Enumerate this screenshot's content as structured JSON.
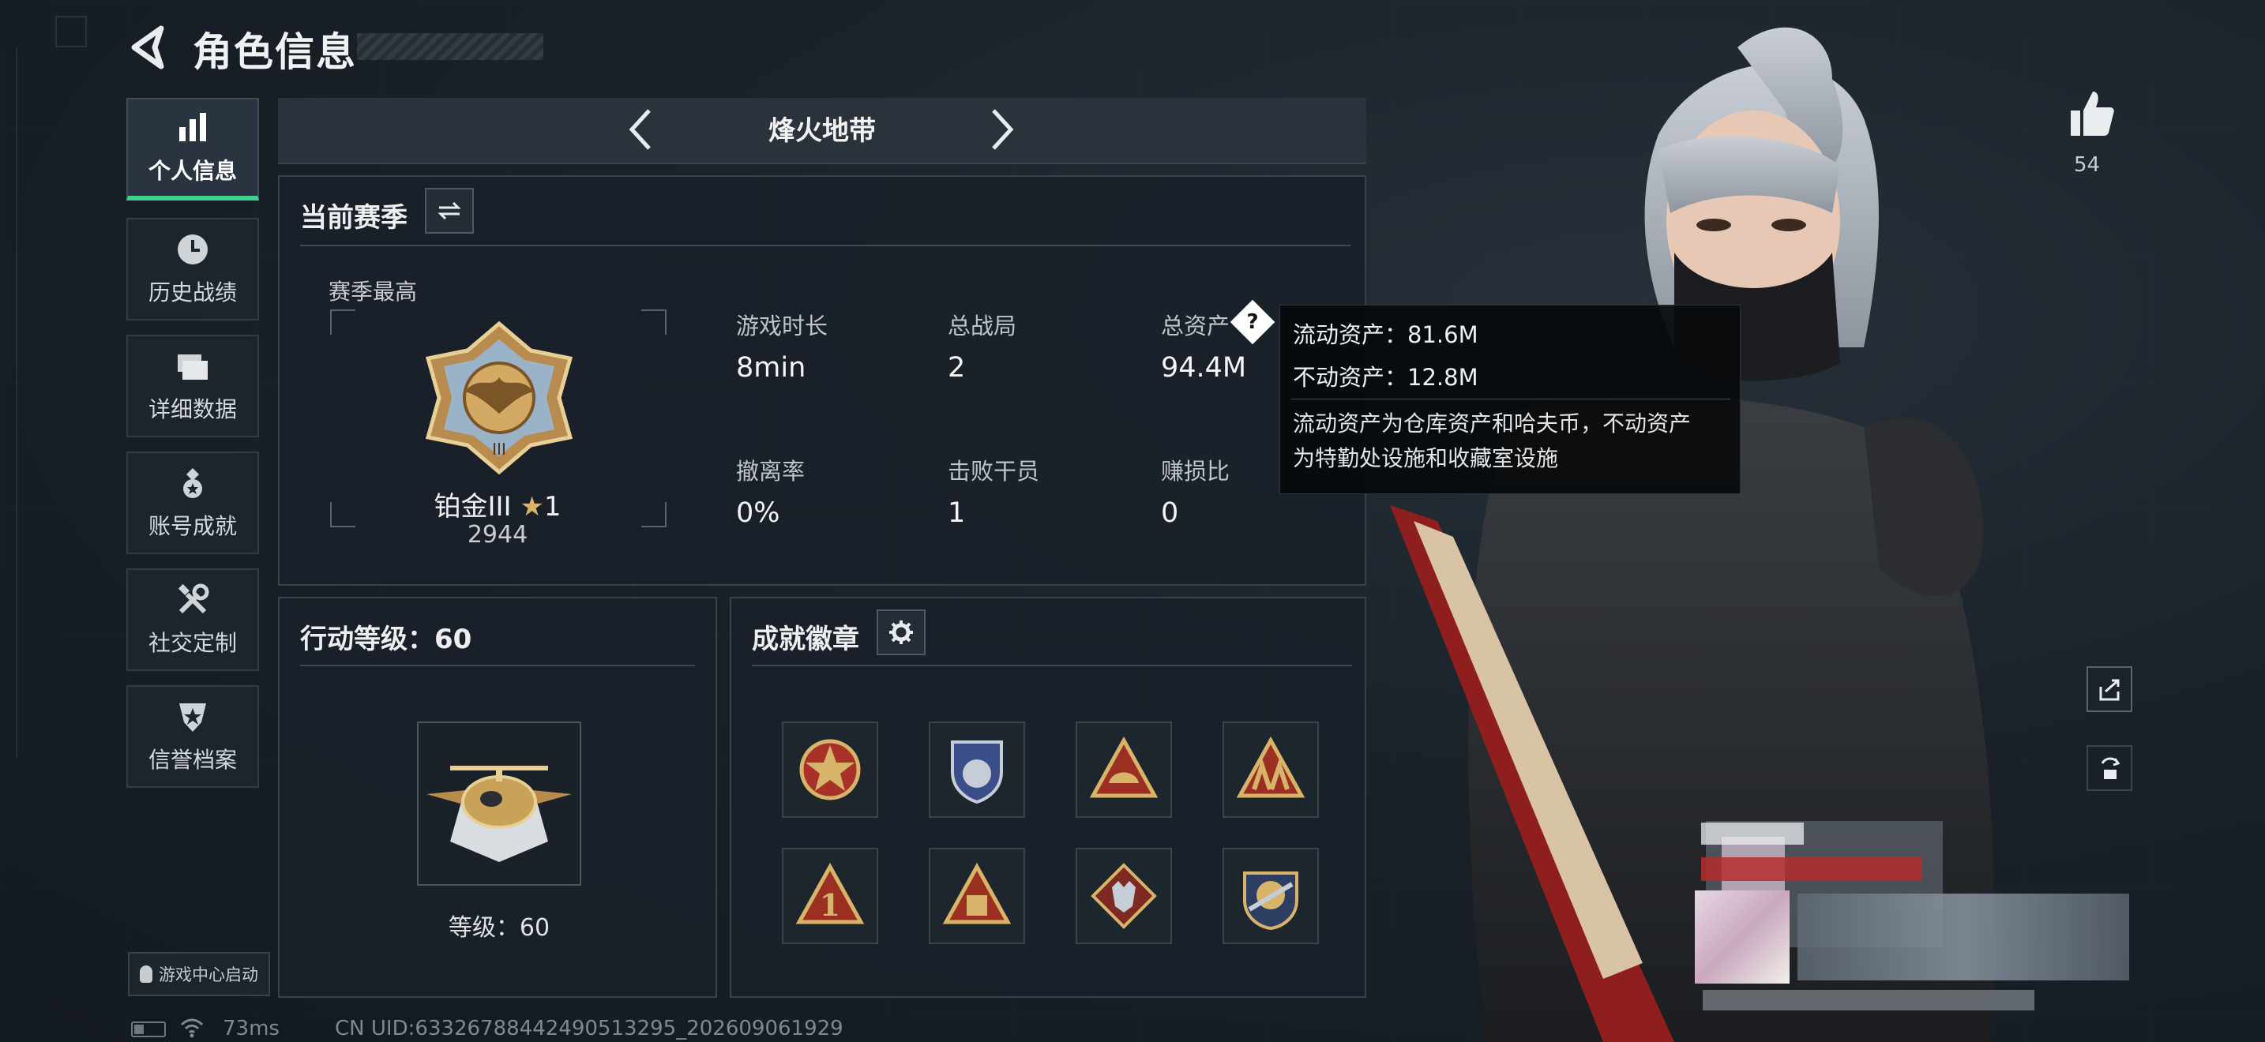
{
  "header": {
    "title": "角色信息"
  },
  "sidebar": {
    "items": [
      {
        "label": "个人信息",
        "icon": "bar-chart-icon",
        "active": true
      },
      {
        "label": "历史战绩",
        "icon": "clock-icon",
        "active": false
      },
      {
        "label": "详细数据",
        "icon": "folder-icon",
        "active": false
      },
      {
        "label": "账号成就",
        "icon": "medal-icon",
        "active": false
      },
      {
        "label": "社交定制",
        "icon": "tools-icon",
        "active": false
      },
      {
        "label": "信誉档案",
        "icon": "shield-star-icon",
        "active": false
      }
    ],
    "launch_label": "游戏中心启动"
  },
  "mode": {
    "name": "烽火地带"
  },
  "season": {
    "title": "当前赛季",
    "best_label": "赛季最高",
    "rank_name": "铂金III",
    "rank_stars": "1",
    "rank_score": "2944",
    "stats": [
      {
        "label": "游戏时长",
        "value": "8min"
      },
      {
        "label": "总战局",
        "value": "2"
      },
      {
        "label": "总资产",
        "value": "94.4M"
      },
      {
        "label": "撤离率",
        "value": "0%"
      },
      {
        "label": "击败干员",
        "value": "1"
      },
      {
        "label": "赚损比",
        "value": "0"
      }
    ]
  },
  "tooltip": {
    "liquid": "流动资产：81.6M",
    "fixed": "不动资产：12.8M",
    "desc1": "流动资产为仓库资产和哈夫币，不动资产",
    "desc2": "为特勤处设施和收藏室设施"
  },
  "action_level": {
    "title": "行动等级：60",
    "level_label": "等级：60"
  },
  "badges": {
    "title": "成就徽章",
    "items": [
      "badge-star-emblem",
      "badge-shield-blue",
      "badge-triangle-helmet",
      "badge-triangle-team",
      "badge-triangle-one",
      "badge-triangle-gold",
      "badge-diamond-wolf",
      "badge-round-rifle"
    ]
  },
  "right": {
    "likes": "54"
  },
  "status": {
    "ping": "73ms",
    "uid": "CN UID:6332678844249051329​5_202609061929"
  },
  "colors": {
    "accent": "#3fd18f",
    "gold": "#c9a25a",
    "background": "#151b22"
  }
}
